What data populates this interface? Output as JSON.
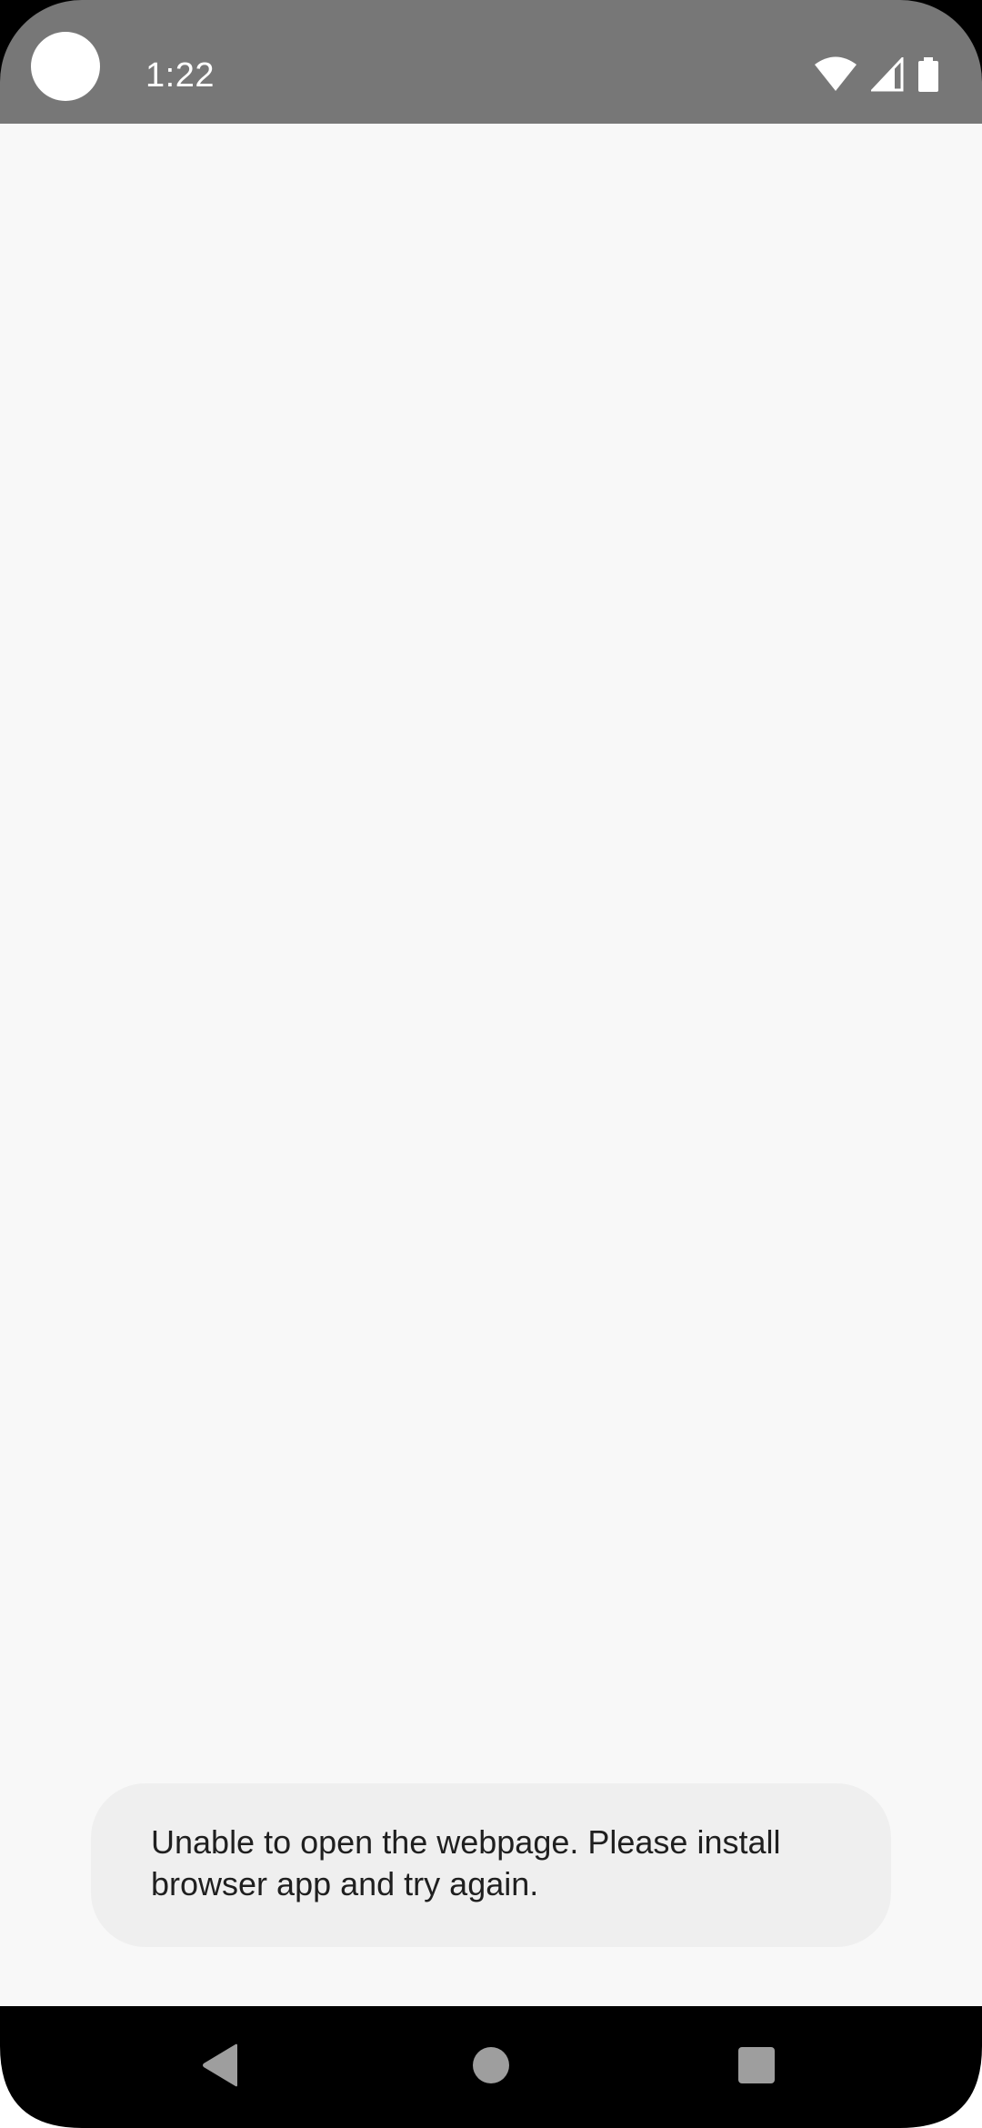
{
  "status_bar": {
    "time": "1:22",
    "icons": [
      "camera-cutout-icon",
      "wifi-icon",
      "cell-signal-icon",
      "battery-icon"
    ],
    "background_color": "#777777"
  },
  "toast": {
    "message": "Unable to open the webpage. Please install browser app and try again."
  },
  "nav_bar": {
    "icons": [
      "back-icon",
      "home-icon",
      "recents-icon"
    ],
    "icon_color": "#9e9e9e"
  }
}
